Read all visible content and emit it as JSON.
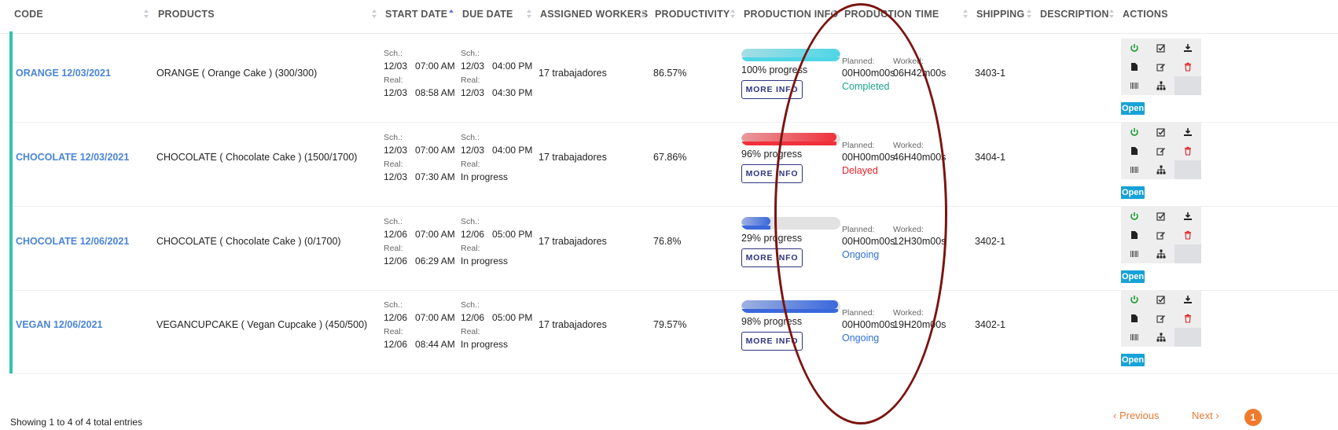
{
  "headers": [
    "CODE",
    "PRODUCTS",
    "START DATE",
    "DUE DATE",
    "ASSIGNED WORKERS",
    "PRODUCTIVITY",
    "PRODUCTION INFO",
    "PRODUCTION TIME",
    "SHIPPING",
    "DESCRIPTION",
    "ACTIONS"
  ],
  "labels": {
    "sch": "Sch.:",
    "real": "Real:",
    "planned": "Planned:",
    "worked": "Worked:",
    "more_info": "MORE INFO",
    "open": "Open"
  },
  "rows": [
    {
      "code": "ORANGE 12/03/2021",
      "product": "ORANGE ( Orange Cake ) (300/300)",
      "start": {
        "sch_date": "12/03",
        "sch_time": "07:00 AM",
        "real_date": "12/03",
        "real_time": "08:58 AM"
      },
      "due": {
        "sch_date": "12/03",
        "sch_time": "04:00 PM",
        "real": "12/03   04:30 PM"
      },
      "workers": "17 trabajadores",
      "productivity": "86.57%",
      "progress_text": "100% progress",
      "progress": 1.0,
      "planned": "00H00m00s",
      "worked": "06H42m00s",
      "status": "Completed",
      "status_color": "#1aa48a",
      "bar_color": "#4ed6e6",
      "shipping": "3403-1"
    },
    {
      "code": "CHOCOLATE 12/03/2021",
      "product": "CHOCOLATE ( Chocolate Cake ) (1500/1700)",
      "start": {
        "sch_date": "12/03",
        "sch_time": "07:00 AM",
        "real_date": "12/03",
        "real_time": "07:30 AM"
      },
      "due": {
        "sch_date": "12/03",
        "sch_time": "04:00 PM",
        "real": "In progress"
      },
      "workers": "17 trabajadores",
      "productivity": "67.86%",
      "progress_text": "96% progress",
      "progress": 0.96,
      "planned": "00H00m00s",
      "worked": "46H40m00s",
      "status": "Delayed",
      "status_color": "#e8202a",
      "bar_color": "#f0303a",
      "shipping": "3404-1"
    },
    {
      "code": "CHOCOLATE 12/06/2021",
      "product": "CHOCOLATE ( Chocolate Cake ) (0/1700)",
      "start": {
        "sch_date": "12/06",
        "sch_time": "07:00 AM",
        "real_date": "12/06",
        "real_time": "06:29 AM"
      },
      "due": {
        "sch_date": "12/06",
        "sch_time": "05:00 PM",
        "real": "In progress"
      },
      "workers": "17 trabajadores",
      "productivity": "76.8%",
      "progress_text": "29% progress",
      "progress": 0.29,
      "planned": "00H00m00s",
      "worked": "12H30m00s",
      "status": "Ongoing",
      "status_color": "#2f6fd6",
      "bar_color": "#3a68dc",
      "shipping": "3402-1"
    },
    {
      "code": "VEGAN 12/06/2021",
      "product": "VEGANCUPCAKE ( Vegan Cupcake ) (450/500)",
      "start": {
        "sch_date": "12/06",
        "sch_time": "07:00 AM",
        "real_date": "12/06",
        "real_time": "08:44 AM"
      },
      "due": {
        "sch_date": "12/06",
        "sch_time": "05:00 PM",
        "real": "In progress"
      },
      "workers": "17 trabajadores",
      "productivity": "79.57%",
      "progress_text": "98% progress",
      "progress": 0.98,
      "planned": "00H00m00s",
      "worked": "19H20m00s",
      "status": "Ongoing",
      "status_color": "#2f6fd6",
      "bar_color": "#3a68dc",
      "shipping": "3402-1"
    }
  ],
  "action_icons": [
    "power-icon",
    "check-square-icon",
    "download-icon",
    "document-icon",
    "edit-icon",
    "trash-icon",
    "barcode-icon",
    "sitemap-icon"
  ],
  "footer": {
    "summary": "Showing 1 to 4 of 4 total entries",
    "previous": "Previous",
    "page": "1",
    "next": "Next"
  }
}
